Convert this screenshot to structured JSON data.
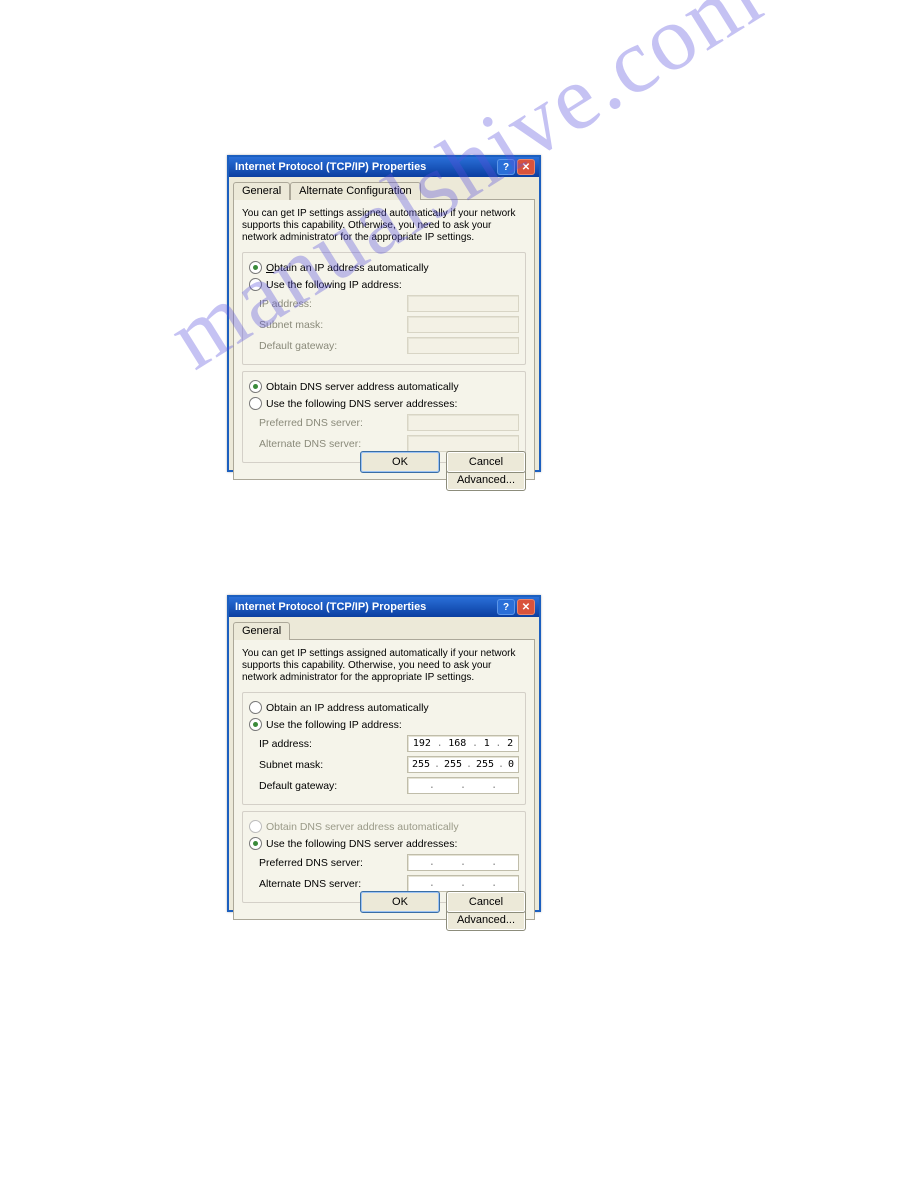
{
  "watermark": "manualshive.com",
  "dialog1": {
    "title": "Internet Protocol (TCP/IP) Properties",
    "tabs": {
      "general": "General",
      "alternate": "Alternate Configuration"
    },
    "description": "You can get IP settings assigned automatically if your network supports this capability. Otherwise, you need to ask your network administrator for the appropriate IP settings.",
    "ip": {
      "auto_label": "Obtain an IP address automatically",
      "manual_label": "Use the following IP address:",
      "selected": "auto",
      "fields": {
        "ip_label": "IP address:",
        "subnet_label": "Subnet mask:",
        "gateway_label": "Default gateway:"
      }
    },
    "dns": {
      "auto_label": "Obtain DNS server address automatically",
      "manual_label": "Use the following DNS server addresses:",
      "selected": "auto",
      "fields": {
        "preferred_label": "Preferred DNS server:",
        "alternate_label": "Alternate DNS server:"
      }
    },
    "buttons": {
      "advanced": "Advanced...",
      "ok": "OK",
      "cancel": "Cancel"
    }
  },
  "dialog2": {
    "title": "Internet Protocol (TCP/IP) Properties",
    "tabs": {
      "general": "General"
    },
    "description": "You can get IP settings assigned automatically if your network supports this capability. Otherwise, you need to ask your network administrator for the appropriate IP settings.",
    "ip": {
      "auto_label": "Obtain an IP address automatically",
      "manual_label": "Use the following IP address:",
      "selected": "manual",
      "fields": {
        "ip_label": "IP address:",
        "subnet_label": "Subnet mask:",
        "gateway_label": "Default gateway:",
        "ip_value": [
          "192",
          "168",
          "1",
          "2"
        ],
        "subnet_value": [
          "255",
          "255",
          "255",
          "0"
        ],
        "gateway_value": [
          "",
          "",
          "",
          ""
        ]
      }
    },
    "dns": {
      "auto_label": "Obtain DNS server address automatically",
      "manual_label": "Use the following DNS server addresses:",
      "selected": "manual",
      "fields": {
        "preferred_label": "Preferred DNS server:",
        "alternate_label": "Alternate DNS server:",
        "preferred_value": [
          "",
          "",
          "",
          ""
        ],
        "alternate_value": [
          "",
          "",
          "",
          ""
        ]
      }
    },
    "buttons": {
      "advanced": "Advanced...",
      "ok": "OK",
      "cancel": "Cancel"
    }
  }
}
